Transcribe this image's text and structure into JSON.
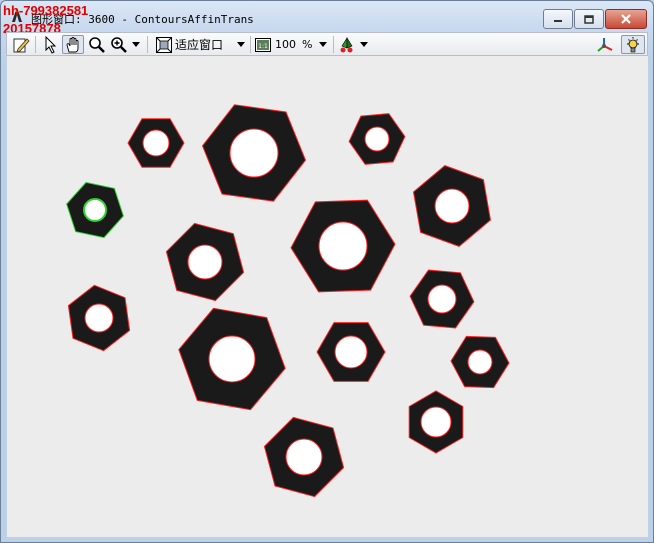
{
  "window": {
    "title": "图形窗口: 3600 - ContoursAffinTrans",
    "watermark_line1": "hh-799382581",
    "watermark_line2": "20157878"
  },
  "toolbar": {
    "fit_window_label": "适应窗口",
    "zoom_value": "100",
    "zoom_unit": "%"
  },
  "colors": {
    "contour": "#ff2020",
    "selected_contour": "#2bd62b",
    "nut": "#1a1a1a",
    "background": "#ececec",
    "watermark": "#e00000"
  }
}
